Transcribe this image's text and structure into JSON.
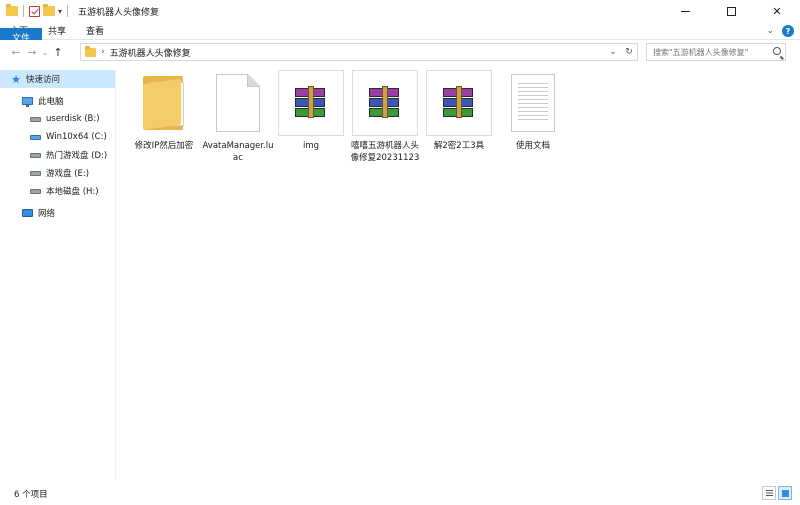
{
  "window": {
    "title": "五游机器人头像修复",
    "controls": {
      "minimize": "",
      "maximize": "",
      "close": "✕"
    }
  },
  "ribbon": {
    "tabs": [
      "文件",
      "主页",
      "共享",
      "查看"
    ],
    "expand_icon": "chevron-down-icon",
    "help_icon": "?"
  },
  "nav": {
    "back": "←",
    "forward": "→",
    "recent": "⌄",
    "up": "↑"
  },
  "address": {
    "path": "五游机器人头像修复",
    "separator": "›"
  },
  "search": {
    "placeholder": "搜索\"五游机器人头像修复\""
  },
  "sidebar": {
    "items": [
      {
        "label": "快速访问",
        "icon": "star-icon"
      },
      {
        "label": "此电脑",
        "icon": "pc-icon"
      },
      {
        "label": "userdisk (B:)",
        "icon": "drive-icon"
      },
      {
        "label": "Win10x64 (C:)",
        "icon": "windows-drive-icon"
      },
      {
        "label": "热门游戏盘 (D:)",
        "icon": "drive-icon"
      },
      {
        "label": "游戏盘 (E:)",
        "icon": "drive-icon"
      },
      {
        "label": "本地磁盘 (H:)",
        "icon": "drive-icon"
      },
      {
        "label": "网络",
        "icon": "network-icon"
      }
    ]
  },
  "files": [
    {
      "name": "修改IP然后加密",
      "icon": "folder-icon"
    },
    {
      "name": "AvataManager.luac",
      "icon": "blank-file-icon"
    },
    {
      "name": "img",
      "icon": "rar-archive-icon"
    },
    {
      "name": "嘻嘻五游机器人头像修复20231123",
      "icon": "rar-archive-icon"
    },
    {
      "name": "解2密2工3具",
      "icon": "rar-archive-icon"
    },
    {
      "name": "使用文档",
      "icon": "text-document-icon"
    }
  ],
  "status": {
    "item_count": "6 个项目"
  }
}
